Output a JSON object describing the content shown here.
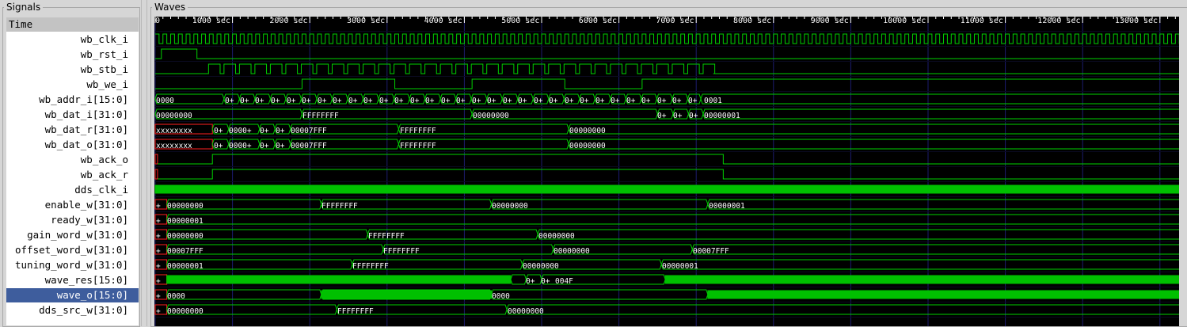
{
  "panes": {
    "signals_title": "Signals",
    "waves_title": "Waves"
  },
  "time_header": "Time",
  "signals": [
    "wb_clk_i",
    "wb_rst_i",
    "wb_stb_i",
    "wb_we_i",
    "wb_addr_i[15:0]",
    "wb_dat_i[31:0]",
    "wb_dat_r[31:0]",
    "wb_dat_o[31:0]",
    "wb_ack_o",
    "wb_ack_r",
    "dds_clk_i",
    "enable_w[31:0]",
    "ready_w[31:0]",
    "gain_word_w[31:0]",
    "offset_word_w[31:0]",
    "tuning_word_w[31:0]",
    "wave_res[15:0]",
    "wave_o[15:0]",
    "dds_src_w[31:0]"
  ],
  "selected_signal": "wave_o[15:0]",
  "time_axis": {
    "labels": [
      "0",
      "1000 sec",
      "2000 sec",
      "3000 sec",
      "4000 sec",
      "5000 sec",
      "6000 sec",
      "7000 sec",
      "8000 sec",
      "9000 sec",
      "10000 sec",
      "11000 sec",
      "12000 sec",
      "13000 sec"
    ]
  },
  "bus_values": {
    "addr_start": "0000",
    "addr_short": "0+",
    "addr_end": "0001",
    "dat_i_zero": "00000000",
    "dat_i_ff": "FFFFFFFF",
    "dat_i_one": "00000001",
    "dat_r_x": "xxxxxxxx",
    "dat_r_short1": "0+",
    "dat_r_short2": "0000+",
    "dat_r_short3": "0+",
    "dat_r_short4": "0+",
    "dat_r_7fff": "00007FFF",
    "dat_r_ff": "FFFFFFFF",
    "dat_r_zero": "00000000",
    "plus": "+",
    "enable_zero": "00000000",
    "enable_ff": "FFFFFFFF",
    "enable_zero2": "00000000",
    "enable_one": "00000001",
    "ready_one": "00000001",
    "gain_zero": "00000000",
    "gain_ff": "FFFFFFFF",
    "gain_zero2": "00000000",
    "offset_7fff": "00007FFF",
    "offset_ff": "FFFFFFFF",
    "offset_zero": "00000000",
    "offset_7fff2": "00007FFF",
    "tuning_one": "00000001",
    "tuning_ff": "FFFFFFFF",
    "tuning_zero": "00000000",
    "tuning_one2": "00000001",
    "wave_res_short1": "0+",
    "wave_res_short2": "0+",
    "wave_res_004f": "004F",
    "wave_o_zero": "0000",
    "wave_o_zero2": "0000",
    "dds_src_zero": "00000000",
    "dds_src_ff": "FFFFFFFF",
    "dds_src_zero2": "00000000"
  },
  "colors": {
    "wave": "#00d000",
    "fill": "#00c000",
    "undefined": "#ff2020",
    "grid": "#1c1c6e",
    "background": "#000000",
    "selected": "#3e5d9d"
  }
}
